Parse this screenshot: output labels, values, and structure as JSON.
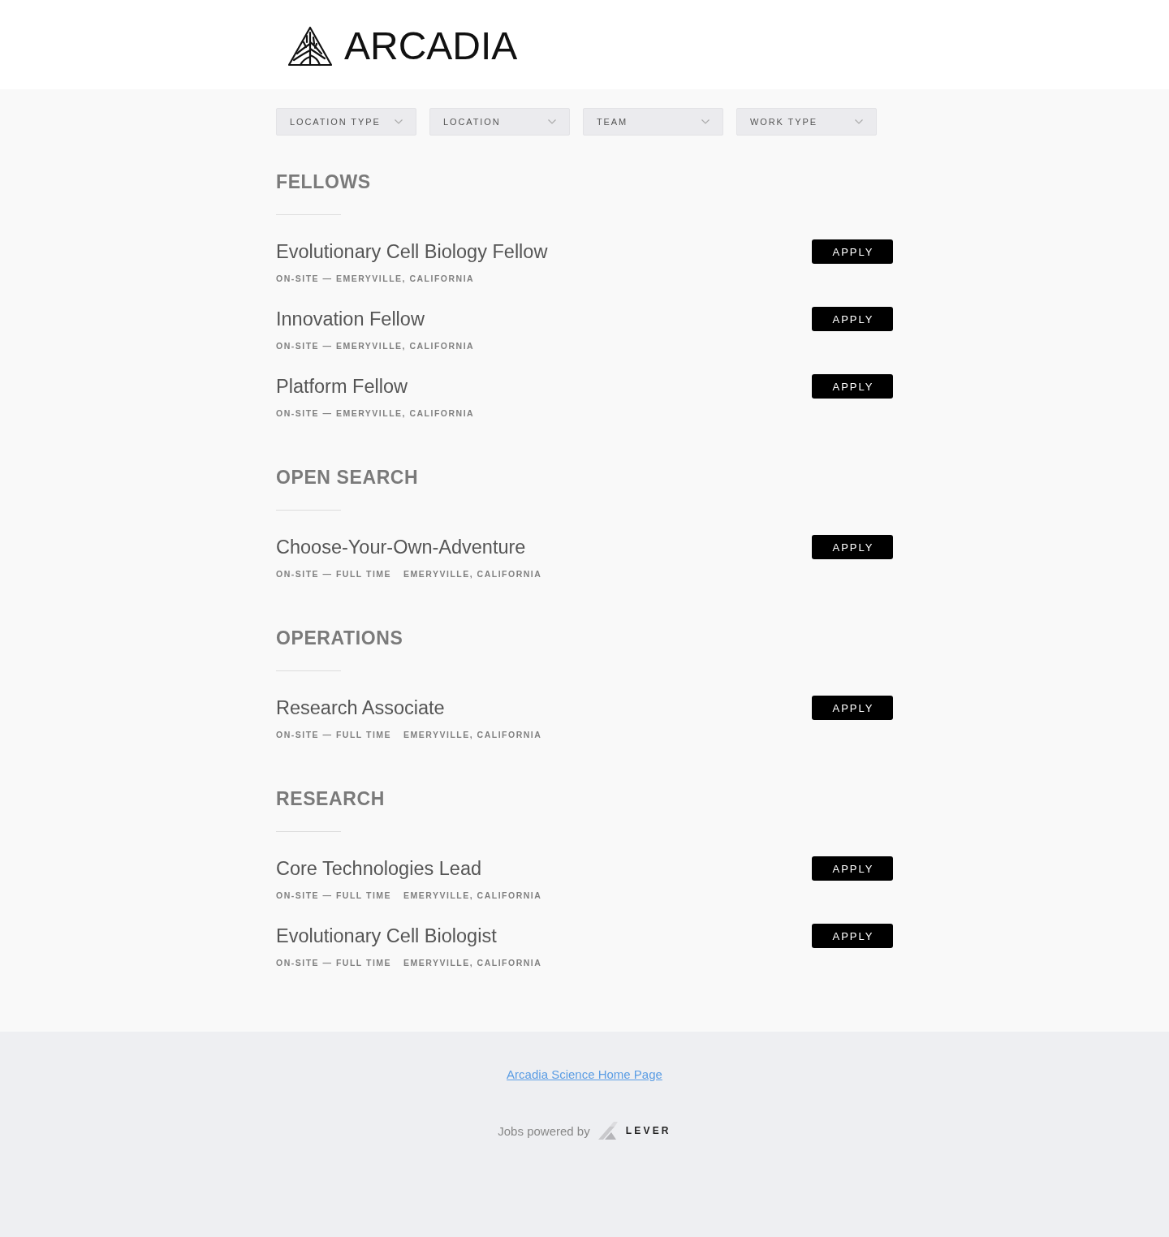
{
  "header": {
    "logo_text": "ARCADIA"
  },
  "filters": [
    {
      "label": "LOCATION TYPE"
    },
    {
      "label": "LOCATION"
    },
    {
      "label": "TEAM"
    },
    {
      "label": "WORK TYPE"
    }
  ],
  "sections": [
    {
      "title": "FELLOWS",
      "postings": [
        {
          "title": "Evolutionary Cell Biology Fellow",
          "meta": [
            "ON-SITE — EMERYVILLE, CALIFORNIA"
          ],
          "button": "APPLY"
        },
        {
          "title": "Innovation Fellow",
          "meta": [
            "ON-SITE — EMERYVILLE, CALIFORNIA"
          ],
          "button": "APPLY"
        },
        {
          "title": "Platform Fellow",
          "meta": [
            "ON-SITE — EMERYVILLE, CALIFORNIA"
          ],
          "button": "APPLY"
        }
      ]
    },
    {
      "title": "OPEN SEARCH",
      "postings": [
        {
          "title": "Choose-Your-Own-Adventure",
          "meta": [
            "ON-SITE — FULL TIME",
            "EMERYVILLE, CALIFORNIA"
          ],
          "button": "APPLY"
        }
      ]
    },
    {
      "title": "OPERATIONS",
      "postings": [
        {
          "title": "Research Associate",
          "meta": [
            "ON-SITE — FULL TIME",
            "EMERYVILLE, CALIFORNIA"
          ],
          "button": "APPLY"
        }
      ]
    },
    {
      "title": "RESEARCH",
      "postings": [
        {
          "title": "Core Technologies Lead",
          "meta": [
            "ON-SITE — FULL TIME",
            "EMERYVILLE, CALIFORNIA"
          ],
          "button": "APPLY"
        },
        {
          "title": "Evolutionary Cell Biologist",
          "meta": [
            "ON-SITE — FULL TIME",
            "EMERYVILLE, CALIFORNIA"
          ],
          "button": "APPLY"
        }
      ]
    }
  ],
  "footer": {
    "link": "Arcadia Science Home Page",
    "powered_by": "Jobs powered by",
    "brand": "LEVER"
  }
}
